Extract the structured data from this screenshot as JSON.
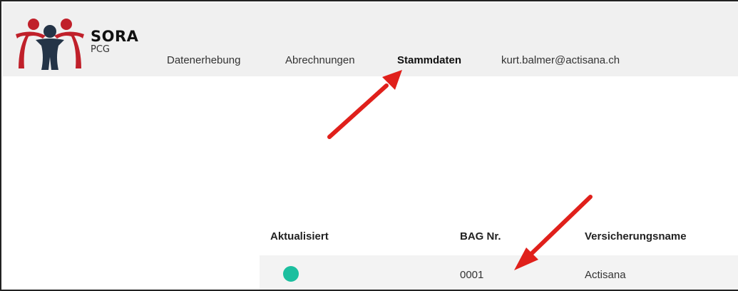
{
  "brand": {
    "name": "SORA",
    "subtitle": "PCG"
  },
  "nav": {
    "items": [
      {
        "label": "Datenerhebung",
        "active": false
      },
      {
        "label": "Abrechnungen",
        "active": false
      },
      {
        "label": "Stammdaten",
        "active": true
      },
      {
        "label": "kurt.balmer@actisana.ch",
        "active": false
      }
    ]
  },
  "table": {
    "headers": [
      "Aktualisiert",
      "BAG Nr.",
      "Versicherungsname"
    ],
    "rows": [
      {
        "updated_status": "updated",
        "bag_nr": "0001",
        "insurance_name": "Actisana"
      }
    ]
  },
  "colors": {
    "navbar_bg": "#f0f0f0",
    "status_dot": "#1cbf9f",
    "annotation_arrow": "#e0201b",
    "logo_red": "#c0202a",
    "logo_dark": "#243447",
    "row_bg": "#f3f3f3"
  },
  "icons": {
    "logo": "sora-people-logo-icon",
    "status": "status-dot-icon",
    "annotation": "red-arrow-icon"
  }
}
